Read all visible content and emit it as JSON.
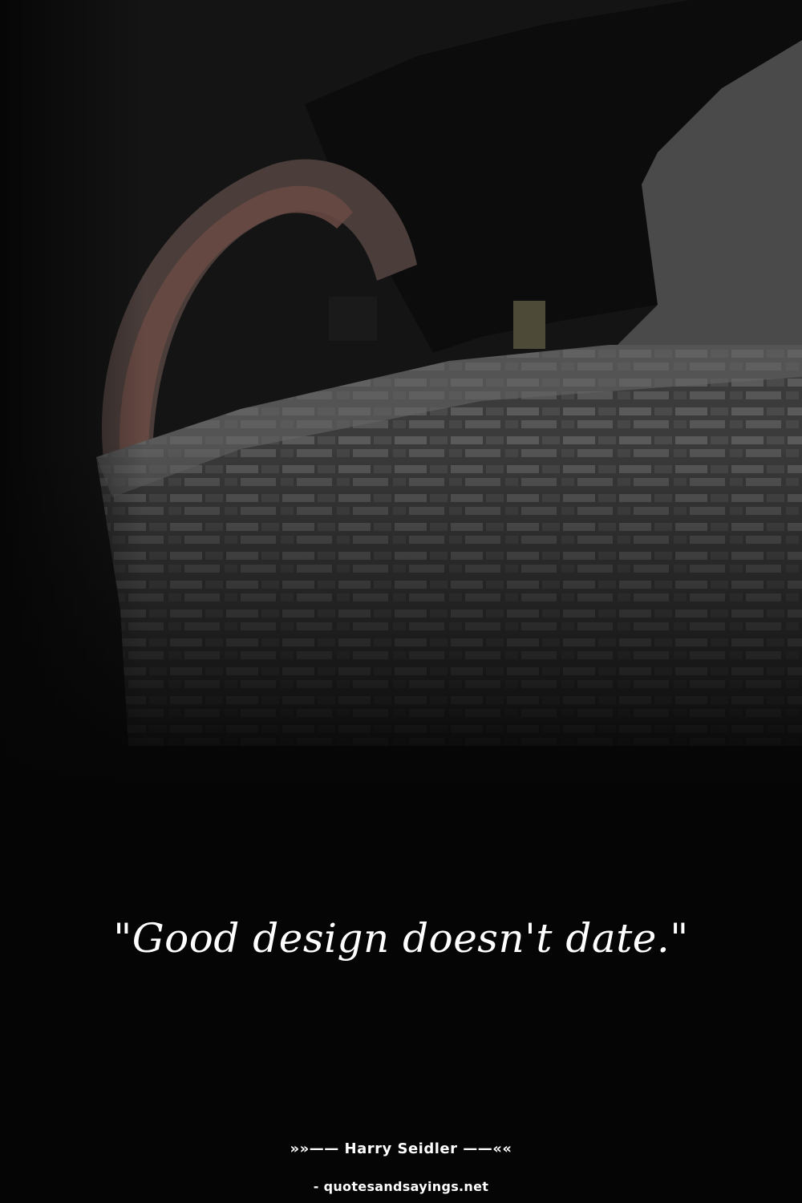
{
  "quote": {
    "text": "\"Good design doesn't date.\""
  },
  "attribution": {
    "author_line": "»»—— Harry Seidler ——««"
  },
  "source": {
    "site": "- quotesandsayings.net"
  },
  "colors": {
    "background": "#050505",
    "text": "#ffffff"
  }
}
